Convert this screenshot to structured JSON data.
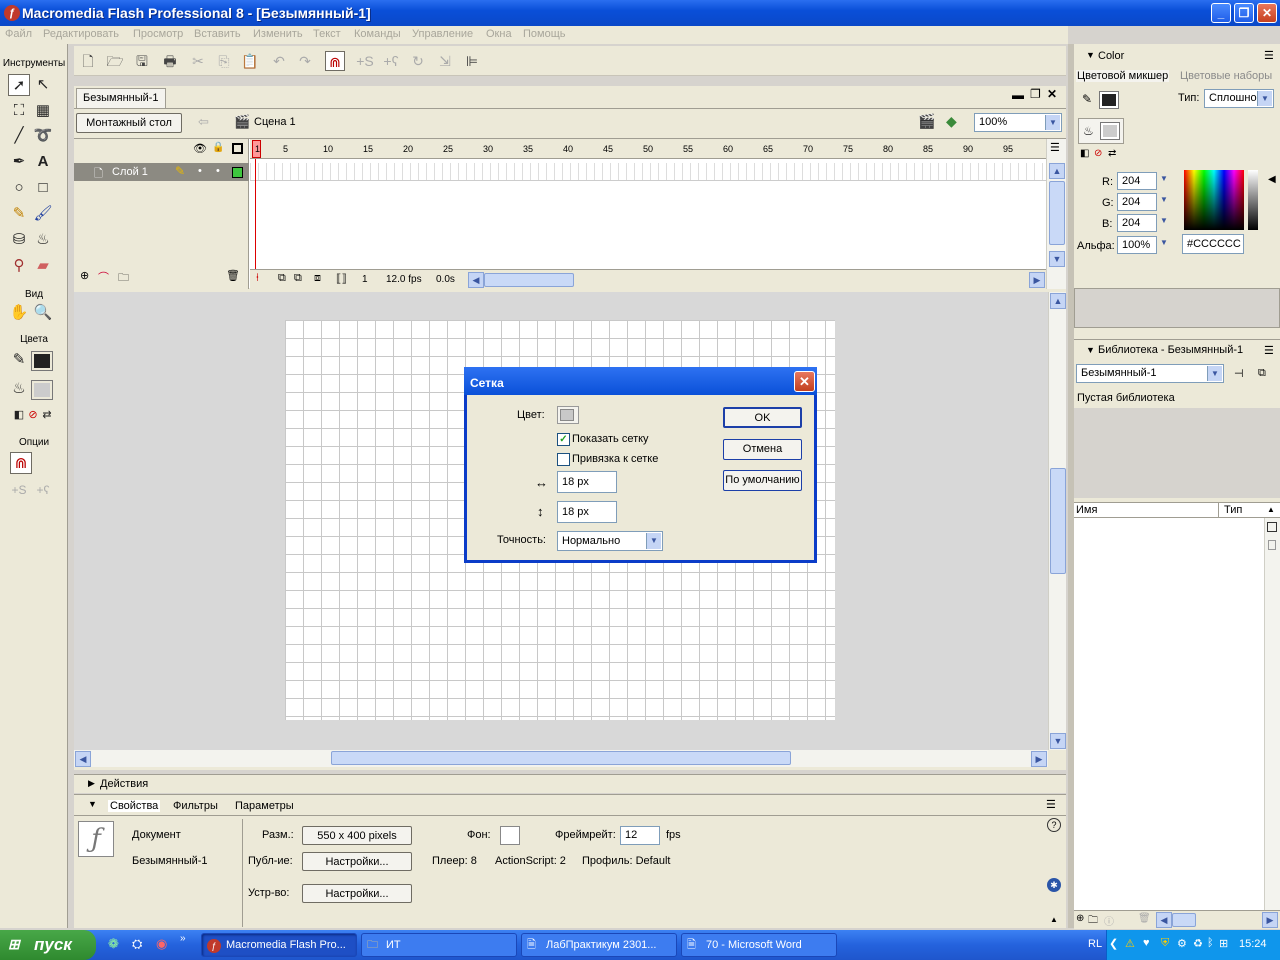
{
  "window": {
    "title": "Macromedia Flash Professional 8 - [Безымянный-1]",
    "minimize": "_",
    "restore": "❐",
    "close": "✕"
  },
  "menu": [
    "Файл",
    "Редактировать",
    "Просмотр",
    "Вставить",
    "Изменить",
    "Текст",
    "Команды",
    "Управление",
    "Окна",
    "Помощь"
  ],
  "tools": {
    "title": "Инструменты",
    "view_label": "Вид",
    "colors_label": "Цвета",
    "options_label": "Опции"
  },
  "document": {
    "tab": "Безымянный-1",
    "timeline_button": "Монтажный стол",
    "scene": "Сцена 1",
    "zoom": "100%",
    "layer_name": "Слой 1",
    "frame_numbers": [
      "1",
      "5",
      "10",
      "15",
      "20",
      "25",
      "30",
      "35",
      "40",
      "45",
      "50",
      "55",
      "60",
      "65",
      "70",
      "75",
      "80",
      "85",
      "90",
      "95"
    ],
    "current_frame": "1",
    "fps": "12.0 fps",
    "time": "0.0s"
  },
  "dialog": {
    "title": "Сетка",
    "color_label": "Цвет:",
    "show_grid": "Показать сетку",
    "show_grid_checked": true,
    "snap_grid": "Привязка к сетке",
    "snap_grid_checked": false,
    "width_value": "18 px",
    "height_value": "18 px",
    "accuracy_label": "Точность:",
    "accuracy_value": "Нормально",
    "ok": "OK",
    "cancel": "Отмена",
    "default": "По умолчанию"
  },
  "color_panel": {
    "title": "Color",
    "tab_mixer": "Цветовой микшер",
    "tab_swatches": "Цветовые наборы",
    "type_label": "Тип:",
    "type_value": "Сплошноі",
    "r_label": "R:",
    "r_value": "204",
    "g_label": "G:",
    "g_value": "204",
    "b_label": "B:",
    "b_value": "204",
    "alpha_label": "Альфа:",
    "alpha_value": "100%",
    "hex": "#CCCCCC",
    "swatch_color": "#cccccc"
  },
  "library_panel": {
    "title": "Библиотека - Безымянный-1",
    "dropdown": "Безымянный-1",
    "empty_text": "Пустая библиотека",
    "col_name": "Имя",
    "col_type": "Тип"
  },
  "actions_panel": {
    "title": "Действия"
  },
  "properties": {
    "tab_props": "Свойства",
    "tab_filters": "Фильтры",
    "tab_params": "Параметры",
    "doc_label": "Документ",
    "doc_name": "Безымянный-1",
    "size_label": "Разм.:",
    "size_value": "550 x 400 pixels",
    "bg_label": "Фон:",
    "framerate_label": "Фреймрейт:",
    "framerate_value": "12",
    "fps_unit": "fps",
    "publish_label": "Публ-ие:",
    "settings_btn": "Настройки...",
    "player": "Плеер: 8",
    "actionscript": "ActionScript:  2",
    "profile": "Профиль: Default",
    "device_label": "Устр-во:",
    "device_btn": "Настройки..."
  },
  "taskbar": {
    "start": "пуск",
    "tasks": [
      "Macromedia Flash Pro...",
      "ИТ",
      "ЛабПрактикум 2301...",
      "70 - Microsoft Word"
    ],
    "lang": "RL",
    "clock": "15:24"
  }
}
